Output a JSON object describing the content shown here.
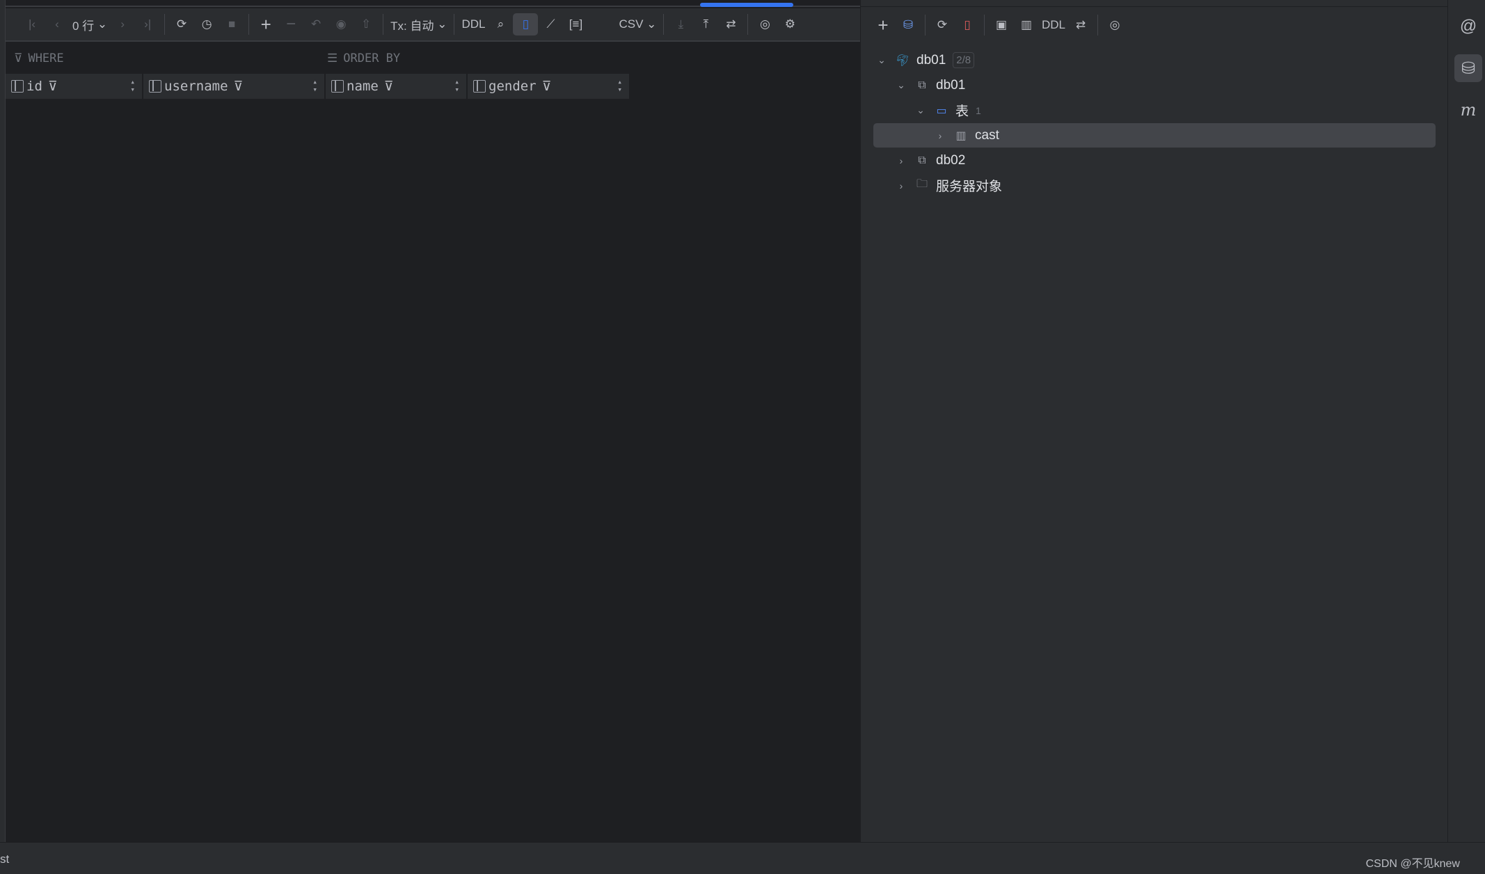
{
  "toolbar": {
    "rows": "0 行",
    "tx": "Tx: 自动",
    "ddl": "DDL",
    "format": "CSV"
  },
  "filter": {
    "where": "WHERE",
    "order_by": "ORDER BY"
  },
  "columns": [
    {
      "name": "id"
    },
    {
      "name": "username"
    },
    {
      "name": "name"
    },
    {
      "name": "gender"
    }
  ],
  "db_toolbar": {
    "ddl": "DDL"
  },
  "tree": [
    {
      "label": "db01",
      "badge": "2/8"
    },
    {
      "label": "db01"
    },
    {
      "label": "表",
      "count": "1"
    },
    {
      "label": "cast"
    },
    {
      "label": "db02"
    },
    {
      "label": "服务器对象"
    }
  ],
  "status": {
    "left": "st",
    "watermark": "CSDN @不见knew"
  },
  "colors": {
    "accent": "#3574f0",
    "bg": "#1e1f22",
    "panel": "#2b2d30",
    "selected": "#43454a"
  }
}
